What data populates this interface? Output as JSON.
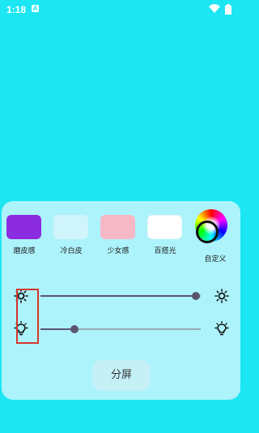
{
  "status_bar": {
    "time": "1:18",
    "notification_badge": "A"
  },
  "presets": [
    {
      "label": "磨皮感",
      "color": "#8b2ce0"
    },
    {
      "label": "冷白皮",
      "color": "#cff4fa"
    },
    {
      "label": "少女感",
      "color": "#f7b8c6"
    },
    {
      "label": "百搭光",
      "color": "#ffffff"
    }
  ],
  "custom_color": {
    "label": "自定义"
  },
  "sliders": {
    "brightness": {
      "level_fraction": 0.97
    },
    "warmth": {
      "level_fraction": 0.21
    }
  },
  "split_button": {
    "label": "分屏"
  },
  "colors": {
    "background": "#1be6f2",
    "panel": "#adf3fb",
    "highlight": "#d4362c"
  }
}
